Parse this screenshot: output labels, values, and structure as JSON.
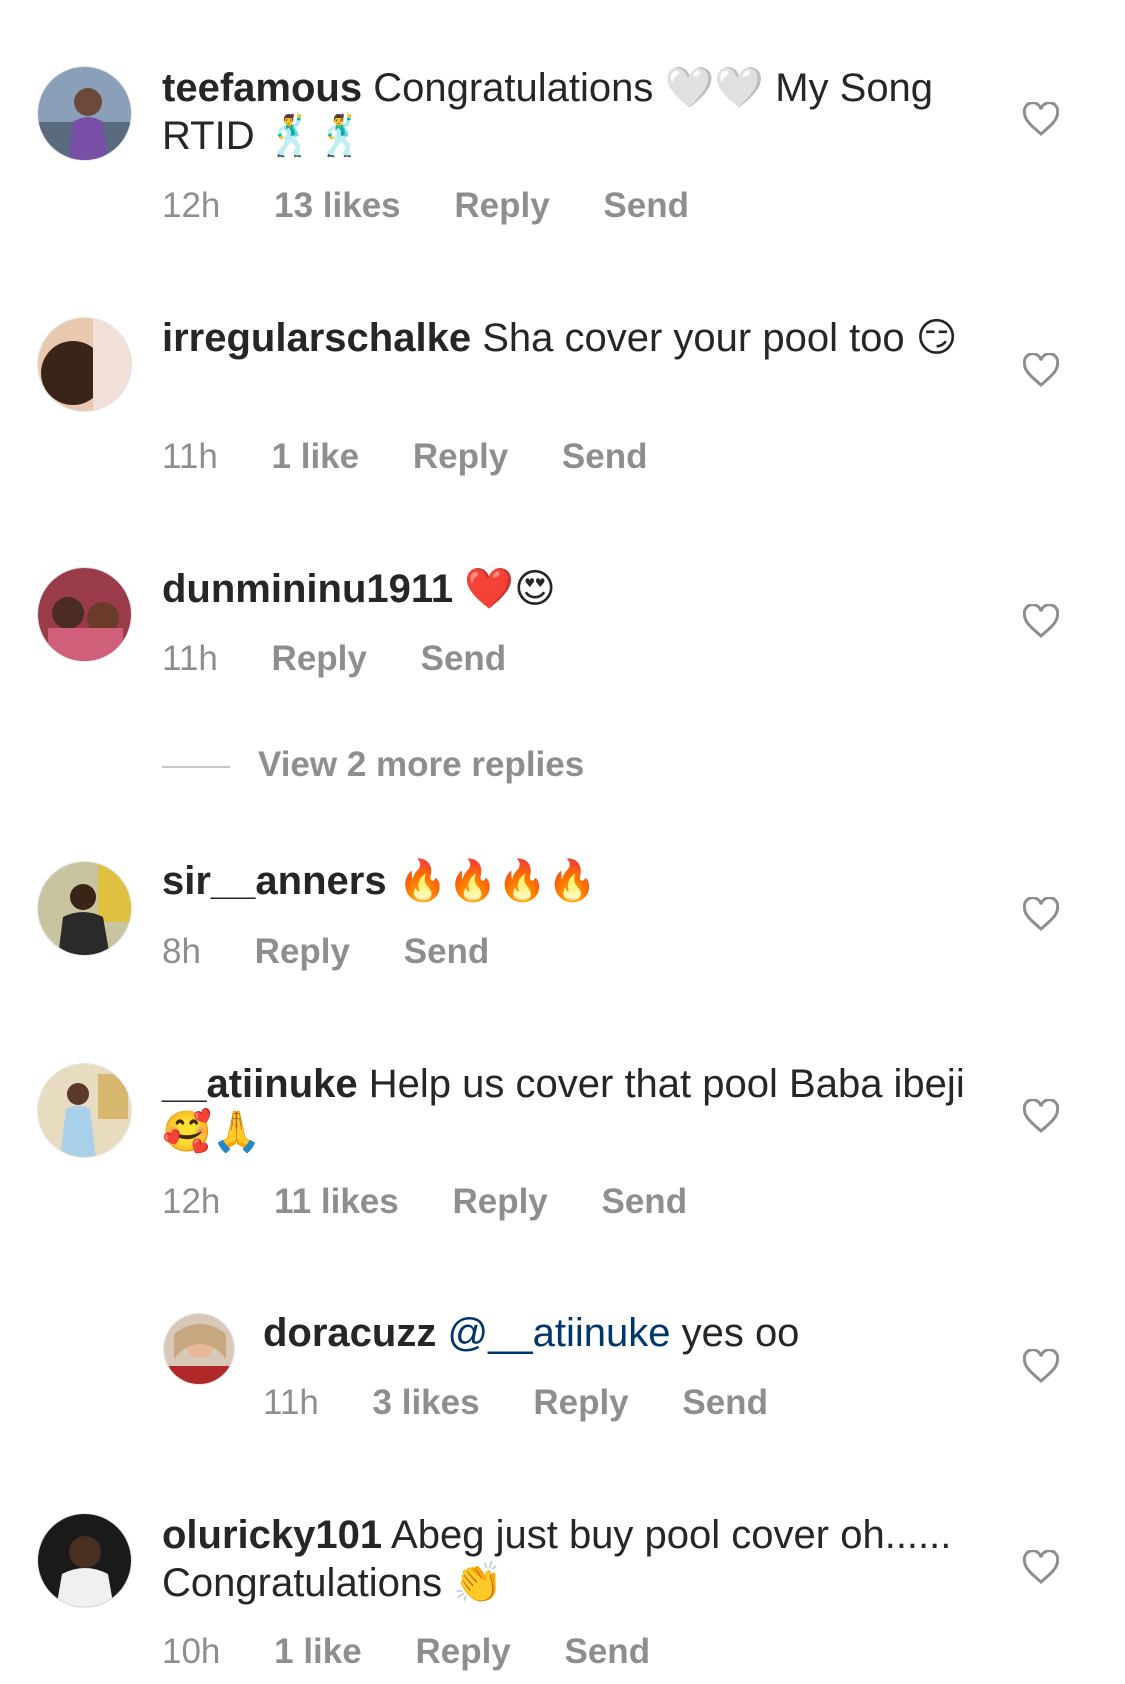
{
  "comments": [
    {
      "username": "teefamous",
      "text": "Congratulations 🤍🤍 My Song RTID 🕺🕺",
      "time": "12h",
      "likes": "13 likes",
      "reply": "Reply",
      "send": "Send"
    },
    {
      "username": "irregularschalke",
      "text": "Sha cover your pool too 😏",
      "time": "11h",
      "likes": "1 like",
      "reply": "Reply",
      "send": "Send"
    },
    {
      "username": "dunmininu1911",
      "text": "❤️😍",
      "time": "11h",
      "reply": "Reply",
      "send": "Send",
      "view_replies": "View 2 more replies"
    },
    {
      "username": "sir__anners",
      "text": "🔥🔥🔥🔥",
      "time": "8h",
      "reply": "Reply",
      "send": "Send"
    },
    {
      "username": "__atiinuke",
      "text": "Help us cover that pool Baba ibeji 🥰🙏",
      "time": "12h",
      "likes": "11 likes",
      "reply": "Reply",
      "send": "Send"
    },
    {
      "username": "doracuzz",
      "mention": "@__atiinuke",
      "text": "yes oo",
      "time": "11h",
      "likes": "3 likes",
      "reply": "Reply",
      "send": "Send"
    },
    {
      "username": "oluricky101",
      "text": "Abeg just buy pool cover oh...... Congratulations 👏",
      "time": "10h",
      "likes": "1 like",
      "reply": "Reply",
      "send": "Send"
    }
  ],
  "icons": {
    "like": "heart-outline-icon"
  },
  "colors": {
    "text": "#262626",
    "meta": "#8e8e8e",
    "mention": "#00376b"
  }
}
